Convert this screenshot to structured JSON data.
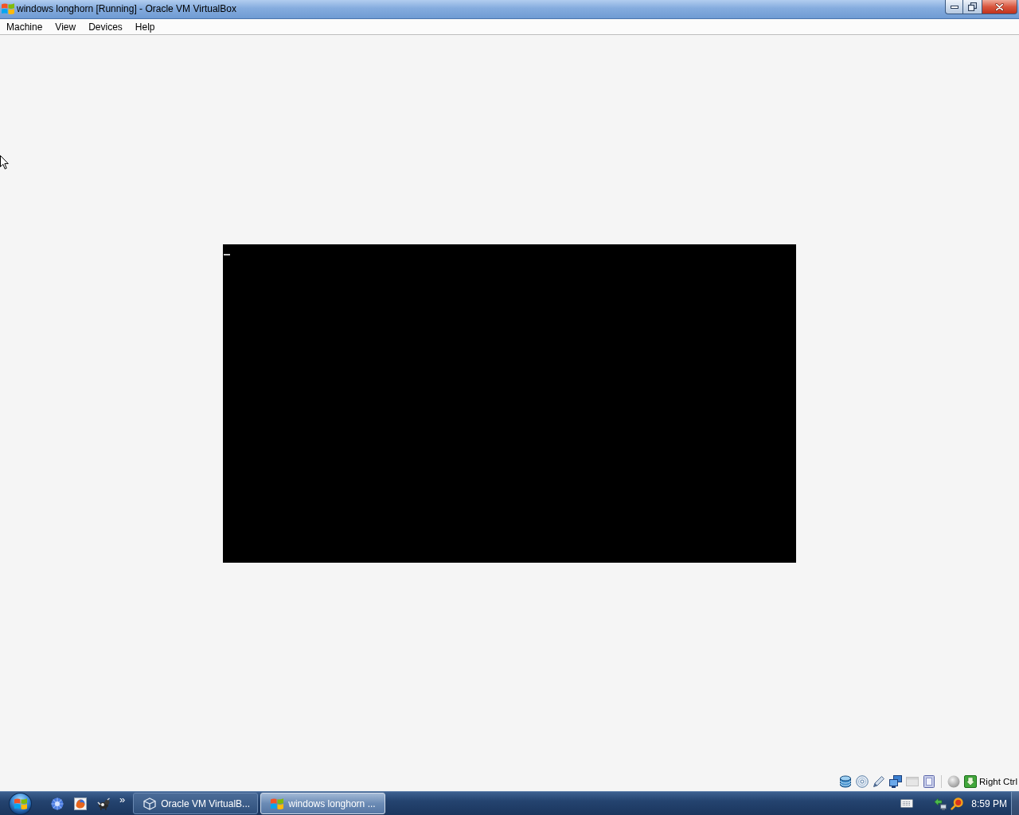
{
  "window": {
    "title": "windows longhorn [Running] - Oracle VM VirtualBox"
  },
  "menu_bar": {
    "items": [
      "Machine",
      "View",
      "Devices",
      "Help"
    ]
  },
  "status_bar": {
    "host_key": "Right Ctrl"
  },
  "taskbar": {
    "quick_launch_more": "»",
    "tasks": [
      {
        "kind": "manager",
        "label": "Oracle VM VirtualB...",
        "selected": false
      },
      {
        "kind": "machine",
        "label": "windows longhorn ...",
        "selected": true
      }
    ],
    "clock": "8:59 PM"
  }
}
